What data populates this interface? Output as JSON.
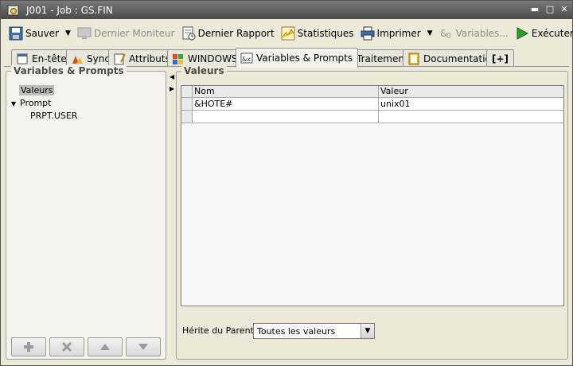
{
  "window": {
    "title": "J001 - Job : GS.FIN"
  },
  "toolbar": {
    "save": "Sauver",
    "last_monitor": "Dernier Moniteur",
    "last_report": "Dernier Rapport",
    "statistics": "Statistiques",
    "print": "Imprimer",
    "variables": "Variables...",
    "execute": "Exécuter"
  },
  "tabs": [
    {
      "label": "En-tête",
      "icon": "header-icon"
    },
    {
      "label": "Sync",
      "icon": "sync-icon"
    },
    {
      "label": "Attributs",
      "icon": "attributes-icon"
    },
    {
      "label": "WINDOWS",
      "icon": "windows-icon"
    },
    {
      "label": "Variables & Prompts",
      "icon": "variables-icon",
      "active": true
    },
    {
      "label": "Traitement",
      "icon": "process-icon"
    },
    {
      "label": "Documentation",
      "icon": "documentation-icon"
    },
    {
      "label": "[+]",
      "icon": "add-tab-icon"
    }
  ],
  "left_panel": {
    "title": "Variables & Prompts",
    "tree": [
      {
        "label": "Valeurs",
        "selected": true
      },
      {
        "label": "Prompt",
        "expanded": true
      },
      {
        "label": "PRPT.USER"
      }
    ],
    "buttons": [
      "add",
      "delete",
      "move-up",
      "move-down"
    ]
  },
  "right_panel": {
    "title": "Valeurs",
    "columns": [
      "Nom",
      "Valeur"
    ],
    "rows": [
      {
        "name": "&HOTE#",
        "value": "unix01"
      },
      {
        "name": "",
        "value": ""
      }
    ],
    "inherit_label": "Hérite du Parent:",
    "inherit_value": "Toutes les valeurs"
  },
  "colors": {
    "titlebar": "#5c5c5c",
    "execute_green": "#2aa02a",
    "selected_bg": "#bdbdbd"
  }
}
